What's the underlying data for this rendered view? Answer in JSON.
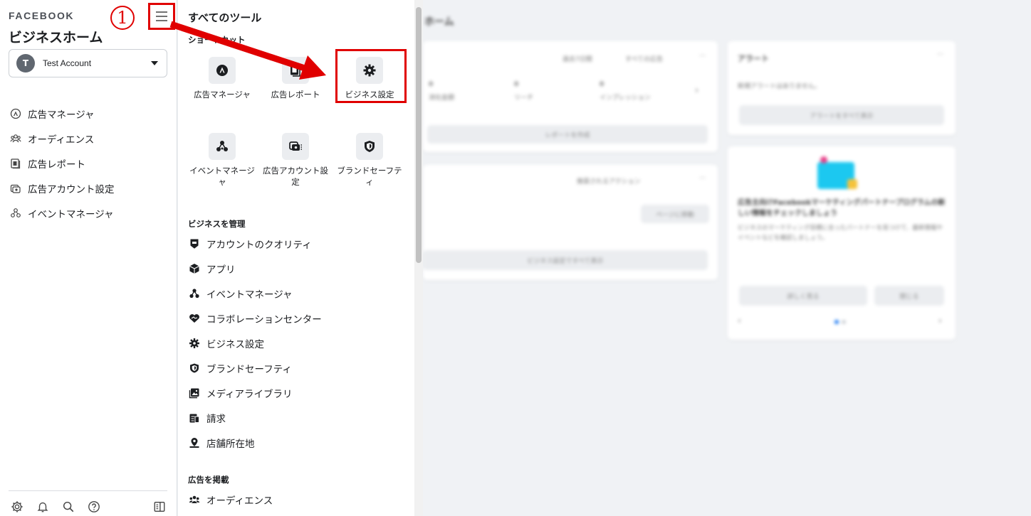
{
  "sidebar": {
    "brand": "FACEBOOK",
    "title": "ビジネスホーム",
    "account": {
      "initial": "T",
      "name": "Test Account"
    },
    "items": [
      {
        "label": "広告マネージャ",
        "icon": "ads-manager-icon"
      },
      {
        "label": "オーディエンス",
        "icon": "audience-icon"
      },
      {
        "label": "広告レポート",
        "icon": "ads-report-icon"
      },
      {
        "label": "広告アカウント設定",
        "icon": "ad-account-settings-icon"
      },
      {
        "label": "イベントマネージャ",
        "icon": "events-manager-icon"
      }
    ]
  },
  "annotation": {
    "step": "1"
  },
  "tools": {
    "title": "すべてのツール",
    "shortcuts_label": "ショートカット",
    "shortcuts": [
      {
        "label": "広告マネージャ",
        "icon": "ads-manager-icon"
      },
      {
        "label": "広告レポート",
        "icon": "ads-report-icon"
      },
      {
        "label": "ビジネス設定",
        "icon": "gear-icon"
      },
      {
        "label": "イベントマネージャ",
        "icon": "events-manager-icon"
      },
      {
        "label": "広告アカウント設定",
        "icon": "ad-account-settings-icon"
      },
      {
        "label": "ブランドセーフティ",
        "icon": "shield-icon"
      }
    ],
    "manage_label": "ビジネスを管理",
    "manage_items": [
      {
        "label": "アカウントのクオリティ",
        "icon": "account-quality-icon"
      },
      {
        "label": "アプリ",
        "icon": "app-cube-icon"
      },
      {
        "label": "イベントマネージャ",
        "icon": "events-manager-icon"
      },
      {
        "label": "コラボレーションセンター",
        "icon": "collab-center-icon"
      },
      {
        "label": "ビジネス設定",
        "icon": "gear-icon"
      },
      {
        "label": "ブランドセーフティ",
        "icon": "shield-icon"
      },
      {
        "label": "メディアライブラリ",
        "icon": "media-library-icon"
      },
      {
        "label": "請求",
        "icon": "billing-icon"
      },
      {
        "label": "店舗所在地",
        "icon": "store-location-icon"
      }
    ],
    "ads_label": "広告を掲載",
    "ads_items": [
      {
        "label": "オーディエンス",
        "icon": "audience-icon"
      }
    ]
  },
  "background": {
    "title": "ホーム",
    "filter1": "過去7日間",
    "filter2": "すべての広告",
    "metric_labels": [
      "リーチ",
      "インプレッション",
      "消化金額"
    ],
    "metric_values": [
      "0",
      "0",
      "0"
    ],
    "report_button": "レポートを作成",
    "recommend_label": "推奨されるアクション",
    "recommend_button": "ページに移動",
    "settings_button": "ビジネス設定ですべて表示",
    "alerts_title": "アラート",
    "alerts_text": "新規アラートはありません。",
    "alerts_button": "アラートをすべて表示",
    "promo_title": "広告主向けFacebookマーケティングパートナープログラムの新しい情報をチェックしましょう",
    "promo_text": "ビジネスのマーケティング目標に合ったパートナーを見つけて、最新情報やイベントなどを確認しましょう。",
    "promo_btn1": "詳しく見る",
    "promo_btn2": "閉じる"
  },
  "colors": {
    "annotation": "#e00000",
    "accent": "#1877f2",
    "promo_image": "#1cc8f0"
  }
}
